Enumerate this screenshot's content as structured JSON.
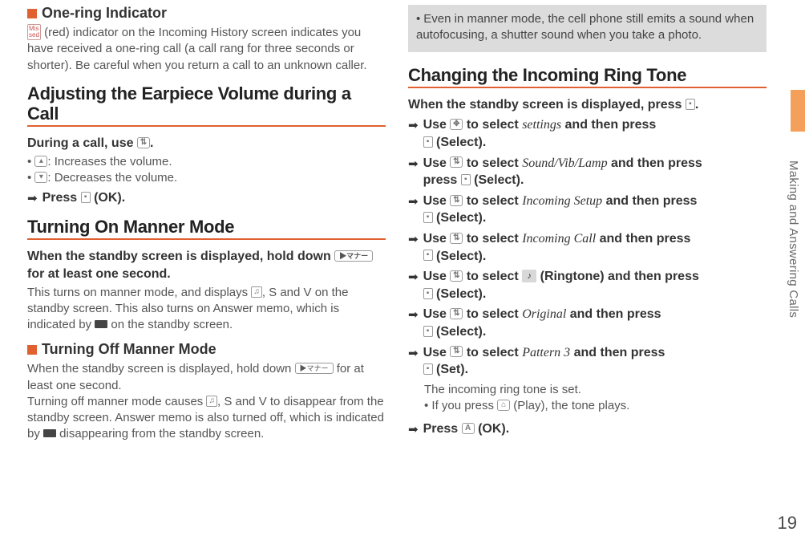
{
  "sideLabel": "Making and Answering Calls",
  "pageNumber": "19",
  "left": {
    "oneRing": {
      "title": "One-ring Indicator",
      "body": " (red) indicator on the Incoming History screen indicates you have received a one-ring call (a call rang for three seconds or shorter). Be careful when you return a call to an unknown caller."
    },
    "earpiece": {
      "title": "Adjusting the Earpiece Volume during a Call",
      "lead_pre": "During a call, use ",
      "lead_post": ".",
      "inc": ": Increases the volume.",
      "dec": ": Decreases the volume.",
      "press_pre": "Press ",
      "press_post": " (OK)."
    },
    "mannerOn": {
      "title": "Turning On Manner Mode",
      "lead1": "When the standby screen is displayed, hold down ",
      "lead2": " for at least one second.",
      "body1": "This turns on manner mode, and displays ",
      "body2": " on the standby screen. This also turns on Answer memo, which is indicated by ",
      "body3": " on the standby screen.",
      "sep": ", ",
      "and": " and "
    },
    "mannerOff": {
      "title": "Turning Off Manner Mode",
      "body1": "When the standby screen is displayed, hold down ",
      "body2": " for at least one second.",
      "body3": "Turning off manner mode causes ",
      "body4": " to disappear from the standby screen. Answer memo is also turned off, which is indicated by ",
      "body5": " disappearing from the standby screen."
    }
  },
  "right": {
    "noteBox": "Even in manner mode, the cell phone still emits a sound when autofocusing, a shutter sound when you take a photo.",
    "ringHead": "Changing the Incoming Ring Tone",
    "lead_pre": "When the standby screen is displayed, press ",
    "lead_post": ".",
    "steps": {
      "use": "Use ",
      "toSelect": " to select ",
      "thenPress": " and then press ",
      "thenPressNL": " and then press",
      "selectEnd": " (Select).",
      "setEnd": " (Set).",
      "settings": "settings",
      "soundVib": "Sound/Vib/Lamp",
      "incomingSetup": "Incoming Setup",
      "incomingCall": "Incoming Call",
      "ringtoneLabel": " (Ringtone) and then press ",
      "original": "Original",
      "pattern3": "Pattern 3",
      "setNote": "The incoming ring tone is set.",
      "playNote_pre": "If you press ",
      "playNote_post": " (Play), the tone plays.",
      "final_pre": "Press ",
      "final_post": " (OK)."
    }
  }
}
